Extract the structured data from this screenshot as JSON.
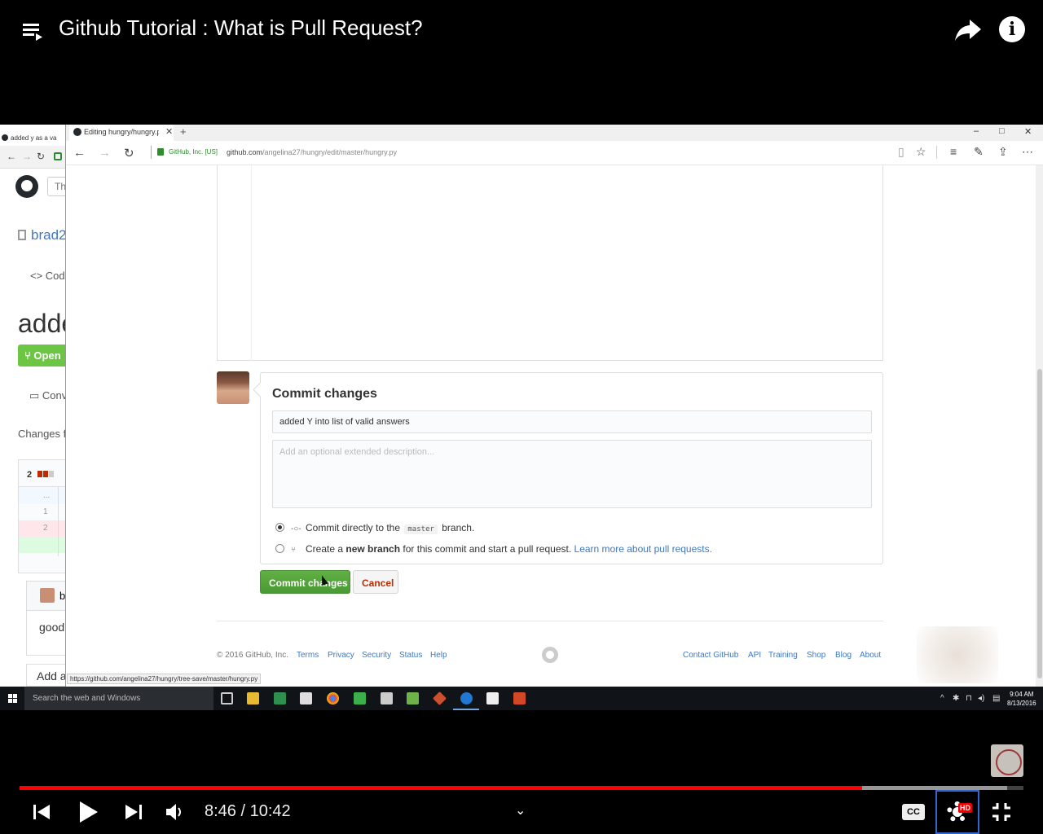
{
  "video": {
    "title": "Github Tutorial : What is Pull Request?",
    "current_time": "8:46",
    "separator": "/",
    "duration": "10:42",
    "progress_fraction": 0.8392,
    "buffered_fraction": 0.9837,
    "controls": {
      "cc_label": "CC",
      "hd_badge": "HD"
    },
    "colors": {
      "progress": "#ff0000",
      "hd_badge": "#ee0000",
      "settings_focus": "#3366cc"
    }
  },
  "background_browser": {
    "tab_label": "added y as a va",
    "search_placeholder": "Th",
    "repo_name": "brad2",
    "code_tab": "Cod",
    "pr_title": "adde",
    "open_badge": "Open",
    "conversation_tab": "Conv",
    "changes_text": "Changes f",
    "diff_count": "2",
    "diff_rows": [
      "...",
      "1",
      "2"
    ],
    "comment_author": "b",
    "comment_body": "good",
    "add_comment": "Add a"
  },
  "browser": {
    "tab_title": "Editing hungry/hungry.py",
    "cert_label": "GitHub, Inc. [US]",
    "url_host": "github.com",
    "url_path": "/angelina27/hungry/edit/master/hungry.py",
    "status_url": "https://github.com/angelina27/hungry/tree-save/master/hungry.py"
  },
  "commit_form": {
    "heading": "Commit changes",
    "summary_value": "added Y into list of valid answers",
    "description_placeholder": "Add an optional extended description...",
    "option_direct_prefix": "Commit directly to the",
    "option_direct_branch": "master",
    "option_direct_suffix": "branch.",
    "option_new_prefix": "Create a",
    "option_new_bold": "new branch",
    "option_new_middle": "for this commit and start a pull request.",
    "option_new_link": "Learn more about pull requests.",
    "selected_option": "direct",
    "commit_button": "Commit changes",
    "cancel_button": "Cancel",
    "colors": {
      "commit_button": "#55a53c",
      "cancel_text": "#bd2c00",
      "link": "#4078c0"
    }
  },
  "footer": {
    "copyright": "© 2016 GitHub, Inc.",
    "left_links": [
      "Terms",
      "Privacy",
      "Security",
      "Status",
      "Help"
    ],
    "right_links": [
      "Contact GitHub",
      "API",
      "Training",
      "Shop",
      "Blog",
      "About"
    ]
  },
  "taskbar": {
    "search_placeholder": "Search the web and Windows",
    "time": "9:04 AM",
    "date": "8/13/2016"
  }
}
